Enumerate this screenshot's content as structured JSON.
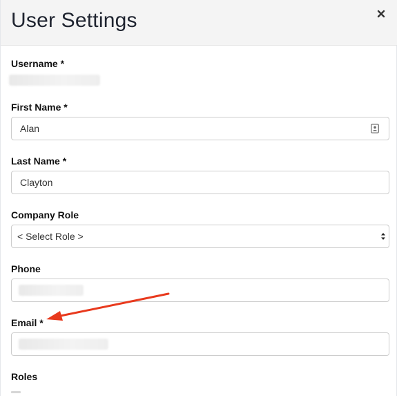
{
  "dialog": {
    "title": "User Settings",
    "close_icon": "close-icon"
  },
  "fields": {
    "username": {
      "label": "Username *",
      "value_redacted": true
    },
    "first_name": {
      "label": "First Name *",
      "value": "Alan",
      "icon": "contact-card-icon"
    },
    "last_name": {
      "label": "Last Name *",
      "value": "Clayton"
    },
    "company_role": {
      "label": "Company Role",
      "selected": "< Select Role >",
      "icon": "select-chevron-icon"
    },
    "phone": {
      "label": "Phone",
      "value_redacted": true
    },
    "email": {
      "label": "Email *",
      "value_redacted": true
    },
    "roles": {
      "label": "Roles"
    }
  },
  "annotation": {
    "arrow_color": "#e8391d",
    "points_to": "Email *"
  },
  "colors": {
    "header_bg": "#f4f4f4",
    "input_border": "#cccccc",
    "label_text": "#111111"
  }
}
